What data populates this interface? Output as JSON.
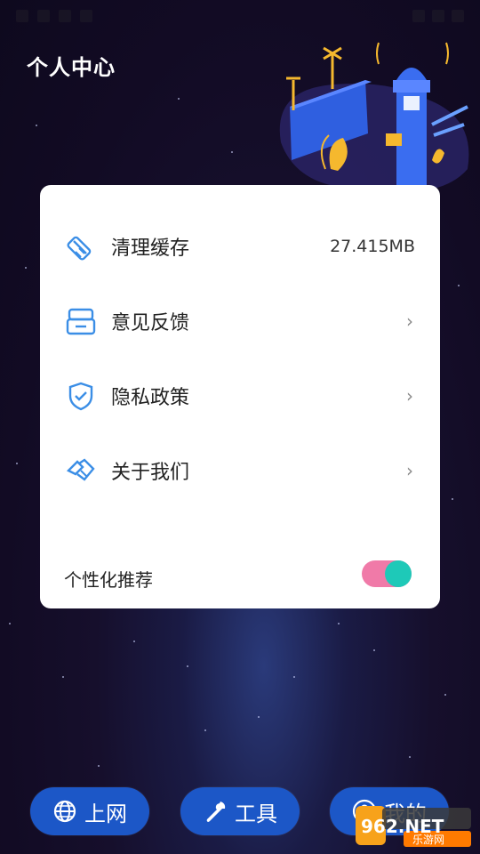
{
  "header": {
    "title": "个人中心"
  },
  "menu": {
    "items": [
      {
        "label": "清理缓存",
        "value": "27.415MB",
        "icon": "broom-icon"
      },
      {
        "label": "意见反馈",
        "value": "",
        "chevron": "›",
        "icon": "feedback-icon"
      },
      {
        "label": "隐私政策",
        "value": "",
        "chevron": "›",
        "icon": "shield-icon"
      },
      {
        "label": "关于我们",
        "value": "",
        "chevron": "›",
        "icon": "handshake-icon"
      }
    ],
    "toggle": {
      "label": "个性化推荐",
      "on": true
    }
  },
  "bottom_nav": [
    {
      "label": "上网",
      "icon": "globe-icon"
    },
    {
      "label": "工具",
      "icon": "wrench-icon"
    },
    {
      "label": "我的",
      "icon": "user-icon"
    }
  ],
  "watermark": {
    "text": "962.NET",
    "subtext": "乐游网"
  },
  "colors": {
    "accent_blue": "#1c57c7",
    "icon_blue": "#3b8ee6",
    "toggle_track": "#f07aa8",
    "toggle_knob": "#1ec9b8"
  }
}
